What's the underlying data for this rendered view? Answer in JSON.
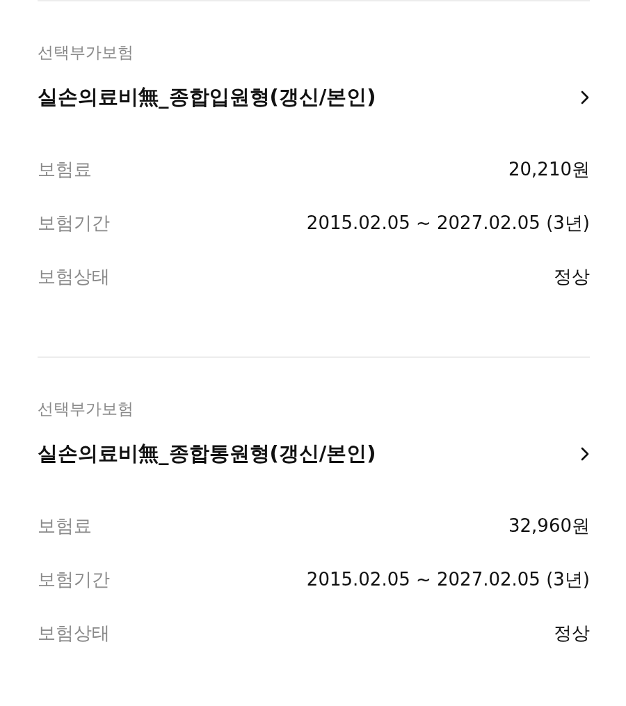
{
  "plans": [
    {
      "category": "선택부가보험",
      "title": "실손의료비無_종합입원형(갱신/본인)",
      "details": [
        {
          "label": "보험료",
          "value": "20,210원"
        },
        {
          "label": "보험기간",
          "value": "2015.02.05 ~ 2027.02.05 (3년)"
        },
        {
          "label": "보험상태",
          "value": "정상"
        }
      ]
    },
    {
      "category": "선택부가보험",
      "title": "실손의료비無_종합통원형(갱신/본인)",
      "details": [
        {
          "label": "보험료",
          "value": "32,960원"
        },
        {
          "label": "보험기간",
          "value": "2015.02.05 ~ 2027.02.05 (3년)"
        },
        {
          "label": "보험상태",
          "value": "정상"
        }
      ]
    }
  ]
}
